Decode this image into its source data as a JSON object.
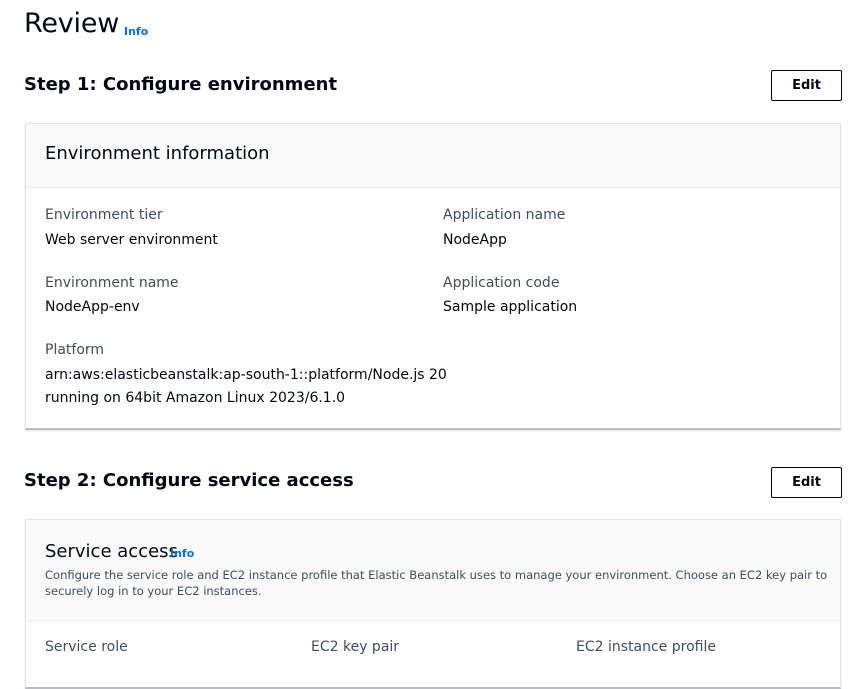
{
  "page": {
    "title": "Review",
    "info_label": "Info"
  },
  "step1": {
    "title": "Step 1: Configure environment",
    "edit_label": "Edit",
    "card": {
      "title": "Environment information",
      "fields": {
        "environment_tier": {
          "label": "Environment tier",
          "value": "Web server environment"
        },
        "application_name": {
          "label": "Application name",
          "value": "NodeApp"
        },
        "environment_name": {
          "label": "Environment name",
          "value": "NodeApp-env"
        },
        "application_code": {
          "label": "Application code",
          "value": "Sample application"
        },
        "platform": {
          "label": "Platform",
          "value_line1": "arn:aws:elasticbeanstalk:ap-south-1::platform/Node.js 20",
          "value_line2": "running on 64bit Amazon Linux 2023/6.1.0"
        }
      }
    }
  },
  "step2": {
    "title": "Step 2: Configure service access",
    "edit_label": "Edit",
    "card": {
      "title": "Service access",
      "info_label": "Info",
      "description_line1": "Configure the service role and EC2 instance profile that Elastic Beanstalk uses to manage your environment. Choose an EC2 key pair to",
      "description_line2": "securely log in to your EC2 instances.",
      "columns": {
        "service_role": "Service role",
        "ec2_key_pair": "EC2 key pair",
        "ec2_instance_profile": "EC2 instance profile"
      }
    }
  }
}
